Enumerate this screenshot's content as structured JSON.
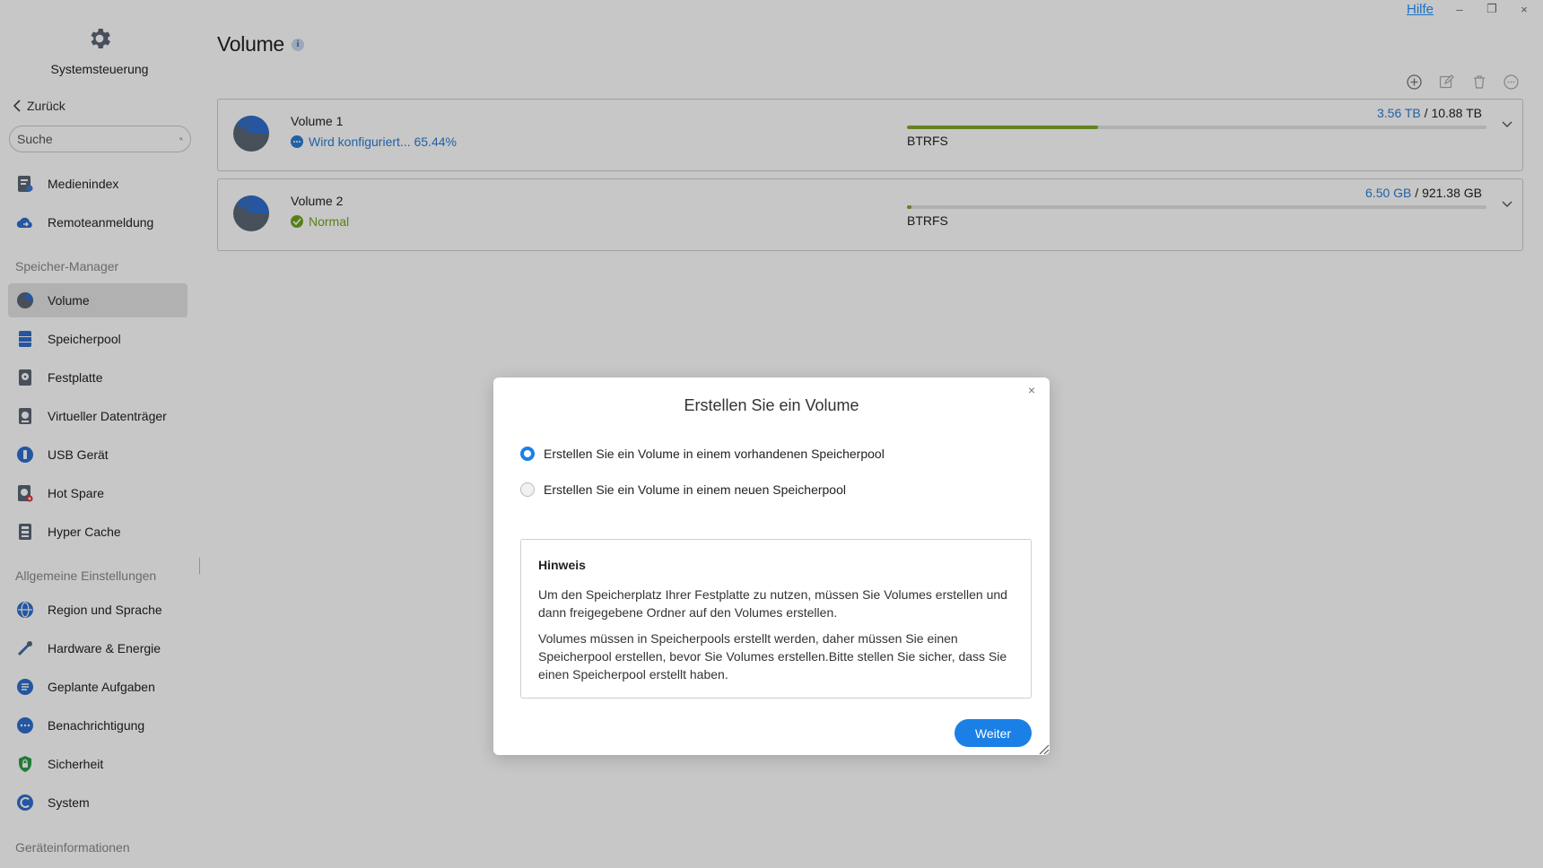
{
  "window": {
    "help": "Hilfe",
    "minimize": "–",
    "restore": "❐",
    "close": "×"
  },
  "app": {
    "title": "Systemsteuerung",
    "back": "Zurück",
    "search_placeholder": "Suche"
  },
  "sidebar": {
    "items_top": [
      {
        "label": "Medienindex",
        "icon": "media-index-icon"
      },
      {
        "label": "Remoteanmeldung",
        "icon": "cloud-remote-icon"
      }
    ],
    "section_storage": "Speicher-Manager",
    "items_storage": [
      {
        "label": "Volume",
        "icon": "volume-pie-icon",
        "active": true
      },
      {
        "label": "Speicherpool",
        "icon": "storage-pool-icon"
      },
      {
        "label": "Festplatte",
        "icon": "hard-disk-icon"
      },
      {
        "label": "Virtueller Datenträger",
        "icon": "virtual-disk-icon"
      },
      {
        "label": "USB Gerät",
        "icon": "usb-icon"
      },
      {
        "label": "Hot Spare",
        "icon": "hot-spare-icon"
      },
      {
        "label": "Hyper Cache",
        "icon": "hyper-cache-icon"
      }
    ],
    "section_general": "Allgemeine Einstellungen",
    "items_general": [
      {
        "label": "Region und Sprache",
        "icon": "globe-icon"
      },
      {
        "label": "Hardware & Energie",
        "icon": "tools-icon"
      },
      {
        "label": "Geplante Aufgaben",
        "icon": "task-list-icon"
      },
      {
        "label": "Benachrichtigung",
        "icon": "chat-bubble-icon"
      },
      {
        "label": "Sicherheit",
        "icon": "shield-icon"
      },
      {
        "label": "System",
        "icon": "system-icon"
      }
    ],
    "section_device": "Geräteinformationen"
  },
  "main": {
    "title": "Volume",
    "info": "i",
    "volumes": [
      {
        "name": "Volume 1",
        "status": "Wird konfiguriert... 65.44%",
        "status_type": "configuring",
        "used": "3.56 TB",
        "sep": " / ",
        "total": "10.88 TB",
        "usage_fraction": 0.33,
        "fs": "BTRFS"
      },
      {
        "name": "Volume 2",
        "status": "Normal",
        "status_type": "normal",
        "used": "6.50 GB",
        "sep": " / ",
        "total": "921.38 GB",
        "usage_fraction": 0.007,
        "fs": "BTRFS"
      }
    ]
  },
  "dialog": {
    "title": "Erstellen Sie ein Volume",
    "close": "×",
    "option_existing": "Erstellen Sie ein Volume in einem vorhandenen Speicherpool",
    "option_new": "Erstellen Sie ein Volume in einem neuen Speicherpool",
    "selected": "existing",
    "note_title": "Hinweis",
    "note_p1": "Um den Speicherplatz Ihrer Festplatte zu nutzen, müssen Sie Volumes erstellen und dann freigegebene Ordner auf den Volumes erstellen.",
    "note_p2": "Volumes müssen in Speicherpools erstellt werden, daher müssen Sie einen Speicherpool erstellen, bevor Sie Volumes erstellen.Bitte stellen Sie sicher, dass Sie einen Speicherpool erstellt haben.",
    "next": "Weiter"
  },
  "colors": {
    "accent": "#1a80e6",
    "link": "#2b7ed4",
    "ok": "#6fa51c",
    "bar": "#7ba82a"
  }
}
